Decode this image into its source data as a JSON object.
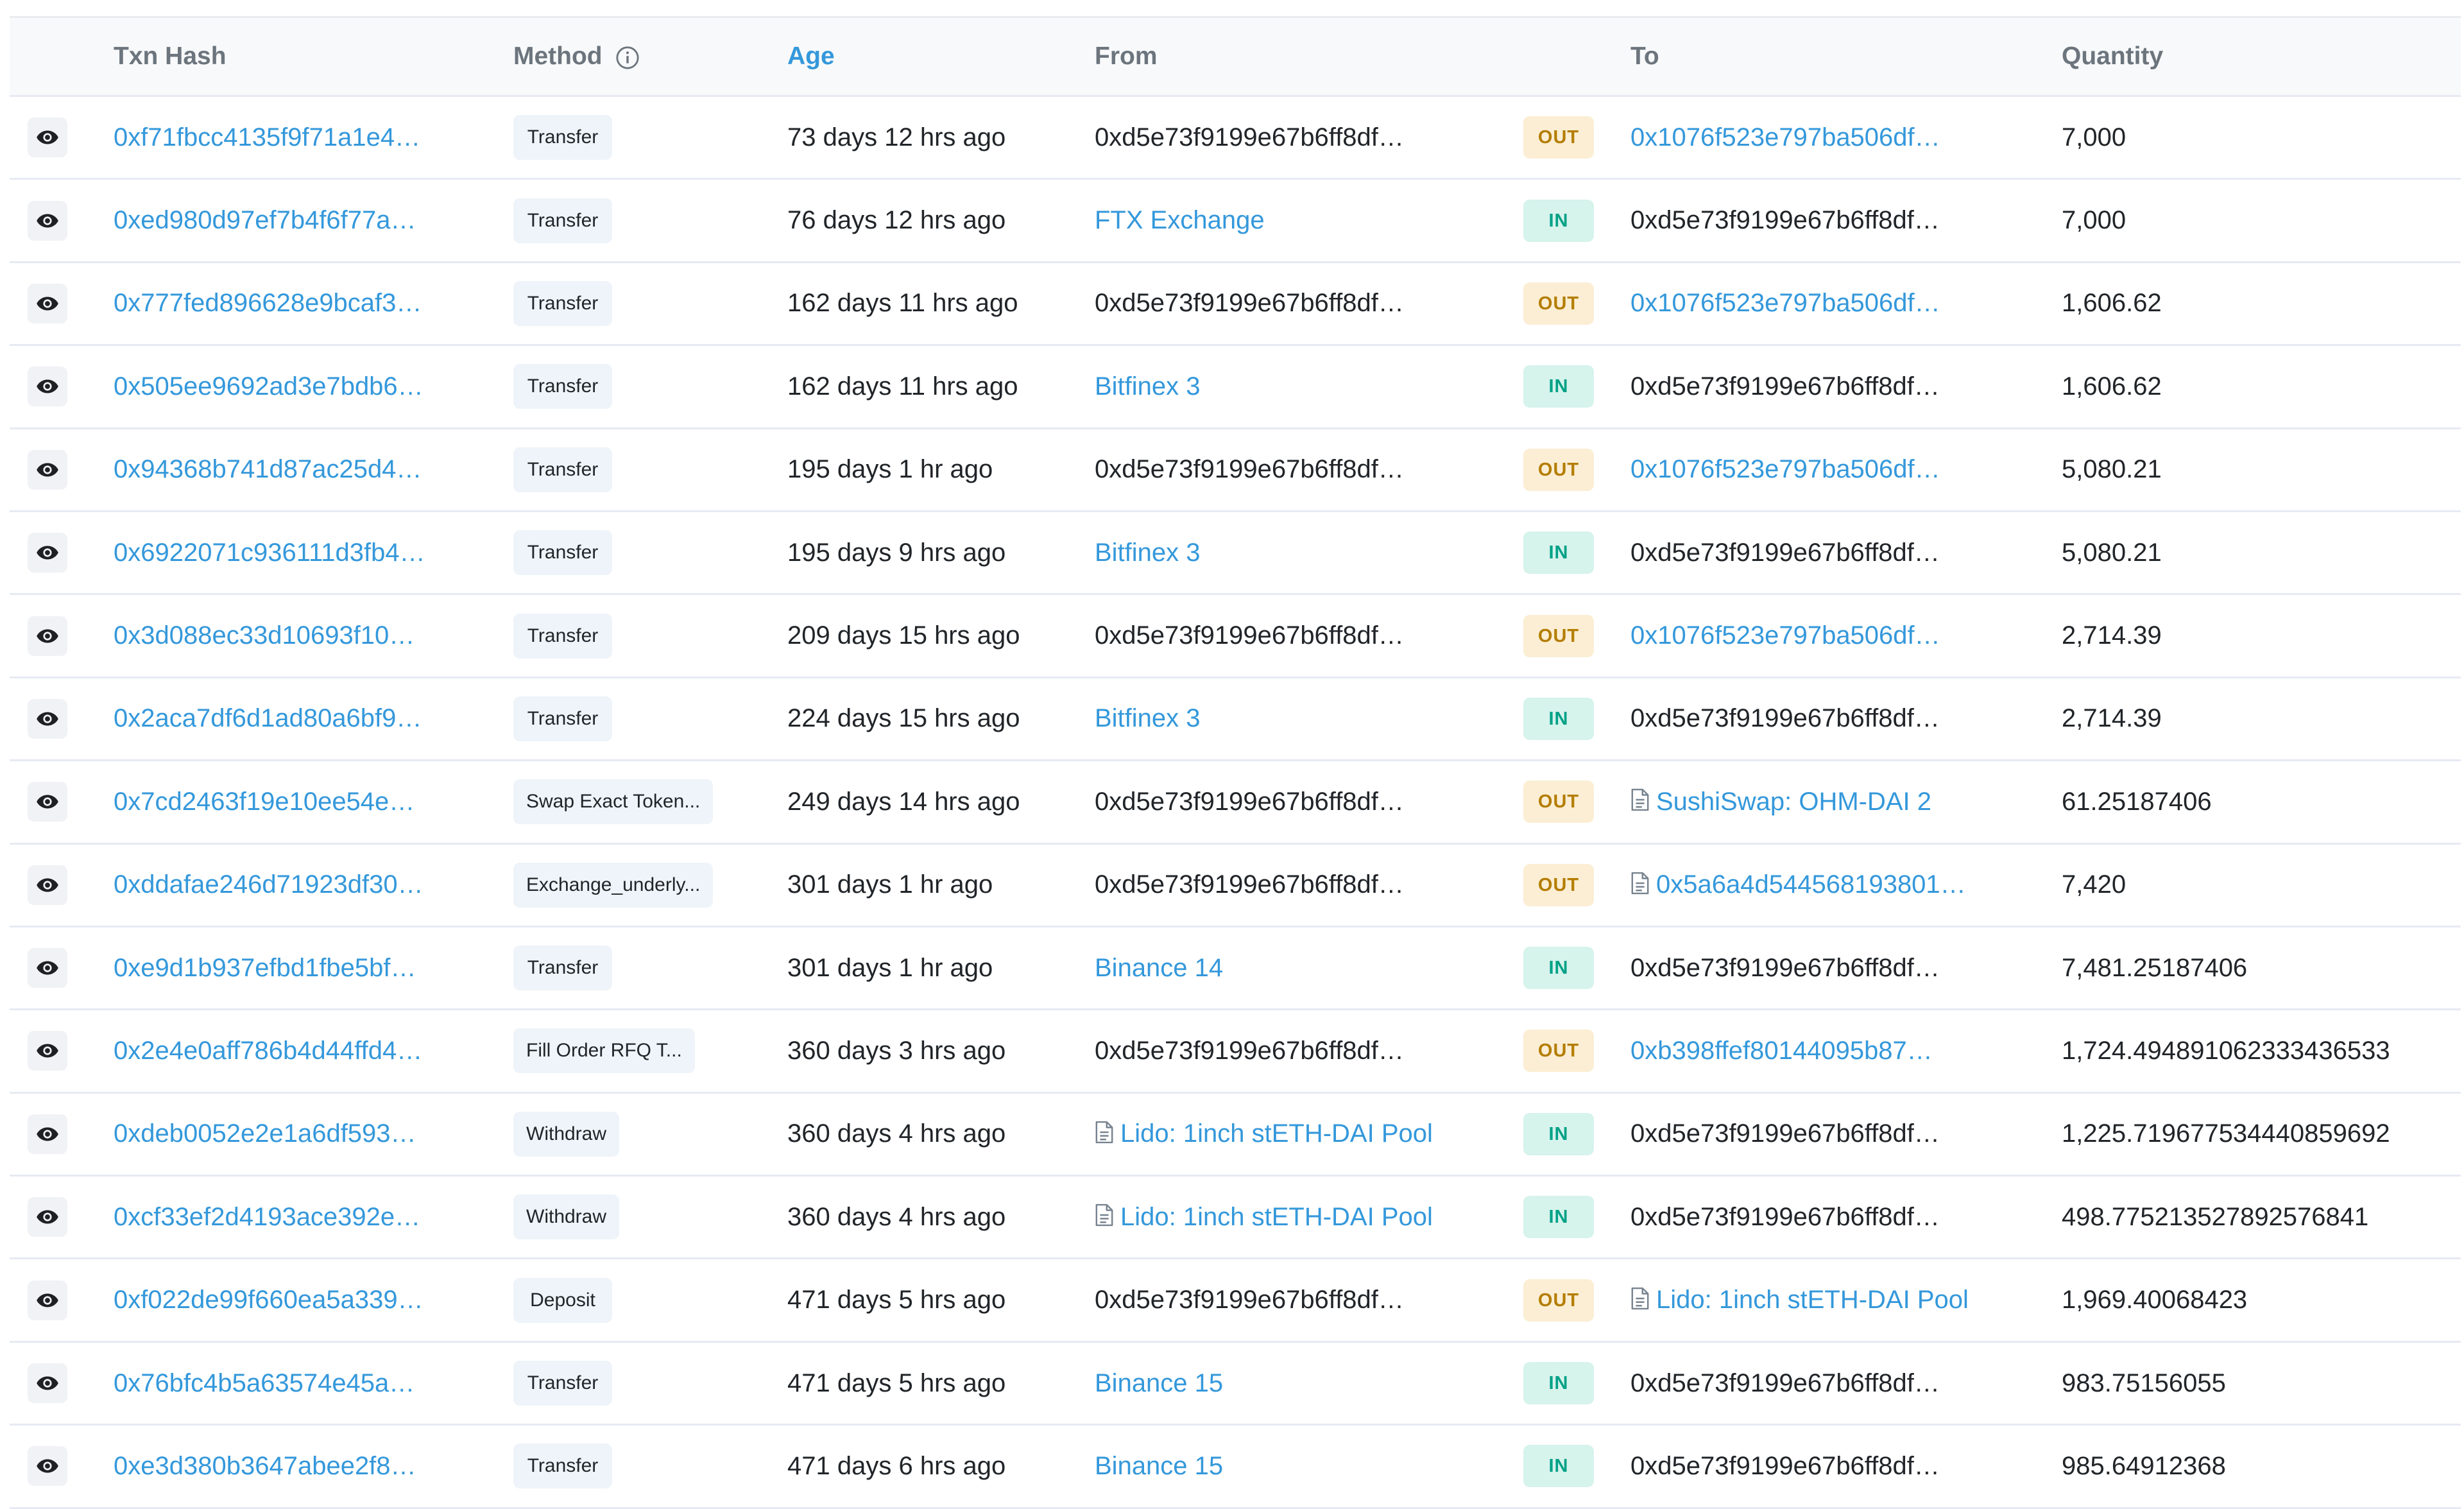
{
  "columns": {
    "txn_hash": "Txn Hash",
    "method": "Method",
    "age": "Age",
    "from": "From",
    "to": "To",
    "quantity": "Quantity"
  },
  "rows": [
    {
      "hash": "0xf71fbcc4135f9f71a1e4…",
      "method": "Transfer",
      "age": "73 days 12 hrs ago",
      "from": "0xd5e73f9199e67b6ff8df…",
      "from_link": false,
      "from_contract": false,
      "dir": "OUT",
      "to": "0x1076f523e797ba506df…",
      "to_link": true,
      "to_contract": false,
      "qty": "7,000"
    },
    {
      "hash": "0xed980d97ef7b4f6f77a…",
      "method": "Transfer",
      "age": "76 days 12 hrs ago",
      "from": "FTX Exchange",
      "from_link": true,
      "from_contract": false,
      "dir": "IN",
      "to": "0xd5e73f9199e67b6ff8df…",
      "to_link": false,
      "to_contract": false,
      "qty": "7,000"
    },
    {
      "hash": "0x777fed896628e9bcaf3…",
      "method": "Transfer",
      "age": "162 days 11 hrs ago",
      "from": "0xd5e73f9199e67b6ff8df…",
      "from_link": false,
      "from_contract": false,
      "dir": "OUT",
      "to": "0x1076f523e797ba506df…",
      "to_link": true,
      "to_contract": false,
      "qty": "1,606.62"
    },
    {
      "hash": "0x505ee9692ad3e7bdb6…",
      "method": "Transfer",
      "age": "162 days 11 hrs ago",
      "from": "Bitfinex 3",
      "from_link": true,
      "from_contract": false,
      "dir": "IN",
      "to": "0xd5e73f9199e67b6ff8df…",
      "to_link": false,
      "to_contract": false,
      "qty": "1,606.62"
    },
    {
      "hash": "0x94368b741d87ac25d4…",
      "method": "Transfer",
      "age": "195 days 1 hr ago",
      "from": "0xd5e73f9199e67b6ff8df…",
      "from_link": false,
      "from_contract": false,
      "dir": "OUT",
      "to": "0x1076f523e797ba506df…",
      "to_link": true,
      "to_contract": false,
      "qty": "5,080.21"
    },
    {
      "hash": "0x6922071c936111d3fb4…",
      "method": "Transfer",
      "age": "195 days 9 hrs ago",
      "from": "Bitfinex 3",
      "from_link": true,
      "from_contract": false,
      "dir": "IN",
      "to": "0xd5e73f9199e67b6ff8df…",
      "to_link": false,
      "to_contract": false,
      "qty": "5,080.21"
    },
    {
      "hash": "0x3d088ec33d10693f10…",
      "method": "Transfer",
      "age": "209 days 15 hrs ago",
      "from": "0xd5e73f9199e67b6ff8df…",
      "from_link": false,
      "from_contract": false,
      "dir": "OUT",
      "to": "0x1076f523e797ba506df…",
      "to_link": true,
      "to_contract": false,
      "qty": "2,714.39"
    },
    {
      "hash": "0x2aca7df6d1ad80a6bf9…",
      "method": "Transfer",
      "age": "224 days 15 hrs ago",
      "from": "Bitfinex 3",
      "from_link": true,
      "from_contract": false,
      "dir": "IN",
      "to": "0xd5e73f9199e67b6ff8df…",
      "to_link": false,
      "to_contract": false,
      "qty": "2,714.39"
    },
    {
      "hash": "0x7cd2463f19e10ee54e…",
      "method": "Swap Exact Token...",
      "age": "249 days 14 hrs ago",
      "from": "0xd5e73f9199e67b6ff8df…",
      "from_link": false,
      "from_contract": false,
      "dir": "OUT",
      "to": "SushiSwap: OHM-DAI 2",
      "to_link": true,
      "to_contract": true,
      "qty": "61.25187406"
    },
    {
      "hash": "0xddafae246d71923df30…",
      "method": "Exchange_underly...",
      "age": "301 days 1 hr ago",
      "from": "0xd5e73f9199e67b6ff8df…",
      "from_link": false,
      "from_contract": false,
      "dir": "OUT",
      "to": "0x5a6a4d544568193801…",
      "to_link": true,
      "to_contract": true,
      "qty": "7,420"
    },
    {
      "hash": "0xe9d1b937efbd1fbe5bf…",
      "method": "Transfer",
      "age": "301 days 1 hr ago",
      "from": "Binance 14",
      "from_link": true,
      "from_contract": false,
      "dir": "IN",
      "to": "0xd5e73f9199e67b6ff8df…",
      "to_link": false,
      "to_contract": false,
      "qty": "7,481.25187406"
    },
    {
      "hash": "0x2e4e0aff786b4d44ffd4…",
      "method": "Fill Order RFQ T...",
      "age": "360 days 3 hrs ago",
      "from": "0xd5e73f9199e67b6ff8df…",
      "from_link": false,
      "from_contract": false,
      "dir": "OUT",
      "to": "0xb398ffef80144095b87…",
      "to_link": true,
      "to_contract": false,
      "qty": "1,724.494891062333436533"
    },
    {
      "hash": "0xdeb0052e2e1a6df593…",
      "method": "Withdraw",
      "age": "360 days 4 hrs ago",
      "from": "Lido: 1inch stETH-DAI Pool",
      "from_link": true,
      "from_contract": true,
      "dir": "IN",
      "to": "0xd5e73f9199e67b6ff8df…",
      "to_link": false,
      "to_contract": false,
      "qty": "1,225.719677534440859692"
    },
    {
      "hash": "0xcf33ef2d4193ace392e…",
      "method": "Withdraw",
      "age": "360 days 4 hrs ago",
      "from": "Lido: 1inch stETH-DAI Pool",
      "from_link": true,
      "from_contract": true,
      "dir": "IN",
      "to": "0xd5e73f9199e67b6ff8df…",
      "to_link": false,
      "to_contract": false,
      "qty": "498.775213527892576841"
    },
    {
      "hash": "0xf022de99f660ea5a339…",
      "method": "Deposit",
      "age": "471 days 5 hrs ago",
      "from": "0xd5e73f9199e67b6ff8df…",
      "from_link": false,
      "from_contract": false,
      "dir": "OUT",
      "to": "Lido: 1inch stETH-DAI Pool",
      "to_link": true,
      "to_contract": true,
      "qty": "1,969.40068423"
    },
    {
      "hash": "0x76bfc4b5a63574e45a…",
      "method": "Transfer",
      "age": "471 days 5 hrs ago",
      "from": "Binance 15",
      "from_link": true,
      "from_contract": false,
      "dir": "IN",
      "to": "0xd5e73f9199e67b6ff8df…",
      "to_link": false,
      "to_contract": false,
      "qty": "983.75156055"
    },
    {
      "hash": "0xe3d380b3647abee2f8…",
      "method": "Transfer",
      "age": "471 days 6 hrs ago",
      "from": "Binance 15",
      "from_link": true,
      "from_contract": false,
      "dir": "IN",
      "to": "0xd5e73f9199e67b6ff8df…",
      "to_link": false,
      "to_contract": false,
      "qty": "985.64912368"
    }
  ],
  "icons": {
    "row_view": "eye-icon",
    "method_info": "info-circle-icon",
    "contract": "document-icon"
  },
  "colors": {
    "link": "#3498db",
    "out_badge_bg": "#fbeed4",
    "out_badge_text": "#b47d00",
    "in_badge_bg": "#d6f3ec",
    "in_badge_text": "#00a186"
  }
}
